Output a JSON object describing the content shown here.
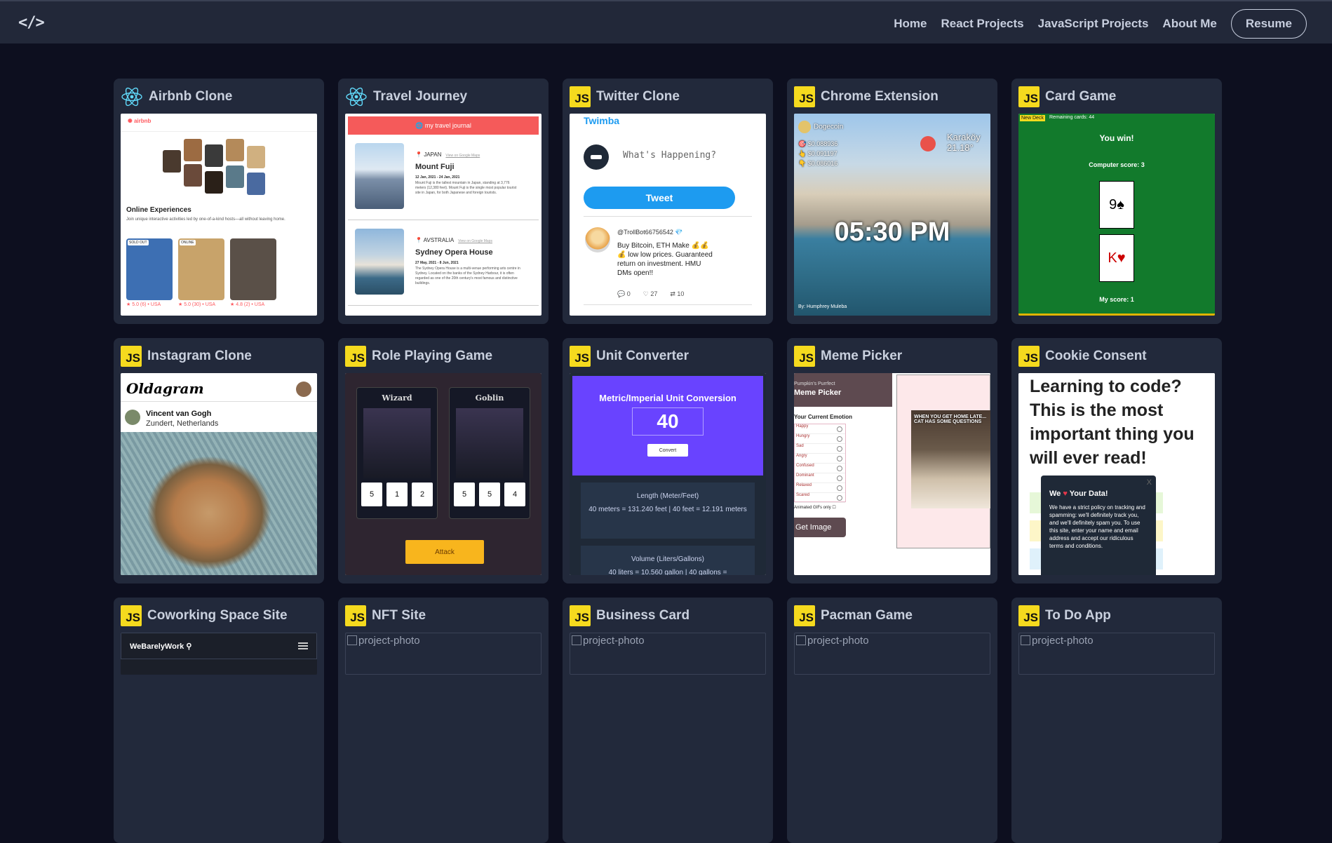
{
  "nav": {
    "logo": "</>",
    "links": [
      "Home",
      "React Projects",
      "JavaScript Projects",
      "About Me"
    ],
    "resume": "Resume"
  },
  "cards": [
    {
      "title": "Airbnb Clone",
      "badge": "react"
    },
    {
      "title": "Travel Journey",
      "badge": "react"
    },
    {
      "title": "Twitter Clone",
      "badge": "JS"
    },
    {
      "title": "Chrome Extension",
      "badge": "JS"
    },
    {
      "title": "Card Game",
      "badge": "JS"
    },
    {
      "title": "Instagram Clone",
      "badge": "JS"
    },
    {
      "title": "Role Playing Game",
      "badge": "JS"
    },
    {
      "title": "Unit Converter",
      "badge": "JS"
    },
    {
      "title": "Meme Picker",
      "badge": "JS"
    },
    {
      "title": "Cookie Consent",
      "badge": "JS"
    },
    {
      "title": "Coworking Space Site",
      "badge": "JS"
    },
    {
      "title": "NFT Site",
      "badge": "JS"
    },
    {
      "title": "Business Card",
      "badge": "JS"
    },
    {
      "title": "Pacman Game",
      "badge": "JS"
    },
    {
      "title": "To Do App",
      "badge": "JS"
    }
  ],
  "js_badge": "JS",
  "broken_alt": "project-photo",
  "airbnb": {
    "brand": "airbnb",
    "heading": "Online Experiences",
    "desc": "Join unique interactive activities led by one-of-a-kind hosts—all without leaving home.",
    "tags": [
      "SOLD OUT",
      "ONLINE"
    ],
    "stars": [
      "5.0 (6) • USA",
      "5.0 (30) • USA",
      "4.8 (2) • USA"
    ],
    "colors": {
      "card1": "#3d6fb3",
      "card2": "#c8a36a",
      "card3": "#5a5048"
    }
  },
  "travel": {
    "header": "my travel journal",
    "link": "View on Google Maps",
    "entries": [
      {
        "country": "JAPAN",
        "title": "Mount Fuji",
        "dates": "12 Jan, 2021 - 24 Jan, 2021",
        "text": "Mount Fuji is the tallest mountain in Japan, standing at 3,776 meters (12,380 feet). Mount Fuji is the single most popular tourist site in Japan, for both Japanese and foreign tourists."
      },
      {
        "country": "AVSTRALIA",
        "title": "Sydney Opera House",
        "dates": "27 May, 2021 - 8 Jun, 2021",
        "text": "The Sydney Opera House is a multi-venue performing arts centre in Sydney. Located on the banks of the Sydney Harbour, it is often regarded as one of the 20th century's most famous and distinctive buildings."
      }
    ]
  },
  "twitter": {
    "logo": "Twimba",
    "placeholder": "What's Happening?",
    "button": "Tweet",
    "handle": "@TrollBot66756542",
    "text": "Buy Bitcoin, ETH Make 💰💰💰 low low prices. Guaranteed return on investment. HMU DMs open!!",
    "replies": "0",
    "likes": "27",
    "retweets": "10"
  },
  "chrome": {
    "coin": "Dogecoin",
    "prices": [
      "$0.088936",
      "$0.091197",
      "$0.086016"
    ],
    "city": "Karaköy",
    "temp": "21.18°",
    "time": "05:30 PM",
    "credit": "By: Humphrey Muleba"
  },
  "cardgame": {
    "new_deck": "New Deck",
    "remaining": "Remaining cards: 44",
    "result": "You win!",
    "computer_score": "Computer score: 3",
    "my_score": "My score: 1",
    "card_top": "9♠",
    "card_bottom": "K♥"
  },
  "instagram": {
    "logo": "Oldagram",
    "name": "Vincent van Gogh",
    "location": "Zundert, Netherlands"
  },
  "rpg": {
    "hero": "Wizard",
    "monster": "Goblin",
    "hero_dice": [
      "5",
      "1",
      "2"
    ],
    "monster_dice": [
      "5",
      "5",
      "4"
    ],
    "attack": "Attack"
  },
  "unit": {
    "title": "Metric/Imperial Unit Conversion",
    "value": "40",
    "button": "Convert",
    "length_title": "Length (Meter/Feet)",
    "length_text": "40 meters = 131.240 feet | 40 feet = 12.191 meters",
    "volume_title": "Volume (Liters/Gallons)",
    "volume_text": "40 liters = 10.560 gallon | 40 gallons ="
  },
  "meme": {
    "subtitle": "Pumpkin's Purrfect",
    "title": "Meme Picker",
    "label": "Your Current Emotion",
    "gif_label": "Animated GIFs only",
    "button": "Get Image",
    "meme_text": "WHEN YOU GET HOME LATE... CAT HAS SOME QUESTIONS",
    "emotions": [
      "Happy",
      "Hungry",
      "Sad",
      "Angry",
      "Confused",
      "Dominant",
      "Relaxed",
      "Scared"
    ]
  },
  "cookie": {
    "headline": "Learning to code? This is the most important thing you will ever read!",
    "modal_title_pre": "We",
    "modal_title_post": "Your Data!",
    "modal_text": "We have a strict policy on tracking and spamming: we'll definitely track you, and we'll definitely spam you. To use this site, enter your name and email address and accept our ridiculous terms and conditions.",
    "close": "X"
  },
  "coworking": {
    "brand": "WeBarelyWork"
  }
}
